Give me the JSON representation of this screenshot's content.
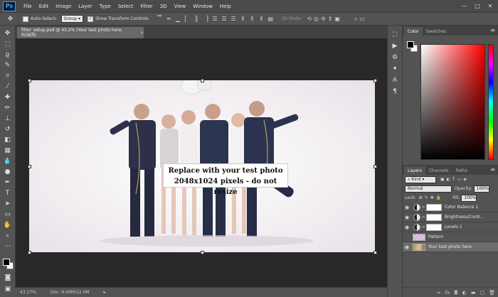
{
  "app": {
    "logo": "Ps"
  },
  "menu": [
    "File",
    "Edit",
    "Image",
    "Layer",
    "Type",
    "Select",
    "Filter",
    "3D",
    "View",
    "Window",
    "Help"
  ],
  "window_controls": [
    "—",
    "□",
    "✕"
  ],
  "options": {
    "auto_select_label": "Auto-Select:",
    "auto_select_value": "Group",
    "show_transform_label": "Show Transform Controls",
    "mode_3d_label": "3D Mode:"
  },
  "document": {
    "tab_title": "filter_setup.psd @ 43.2% (Your test photo here, RGB/8)",
    "tab_close": "×",
    "sign_line1": "Replace with your test photo",
    "sign_line2": "2048x1024 pixels - do not resize"
  },
  "status": {
    "zoom": "43.17%",
    "doc": "Doc: 6.00M/12.0M"
  },
  "panels": {
    "color_tab": "Color",
    "swatches_tab": "Swatches",
    "layers_tab": "Layers",
    "channels_tab": "Channels",
    "paths_tab": "Paths",
    "kind_label": "Kind",
    "blend_mode": "Normal",
    "opacity_label": "Opacity:",
    "opacity_value": "100%",
    "lock_label": "Lock:",
    "fill_label": "Fill:",
    "fill_value": "100%"
  },
  "layers": [
    {
      "name": "Color Balance 1",
      "type": "adjustment",
      "visible": true
    },
    {
      "name": "Brightness/Contr...",
      "type": "adjustment",
      "visible": true
    },
    {
      "name": "Levels 1",
      "type": "adjustment",
      "visible": true
    },
    {
      "name": "Pattern",
      "type": "image",
      "visible": false
    },
    {
      "name": "Your test photo here",
      "type": "image",
      "visible": true,
      "selected": true
    }
  ],
  "colors": {
    "ui_bg": "#535353",
    "workspace": "#282828",
    "accent": "#31a8ff"
  }
}
